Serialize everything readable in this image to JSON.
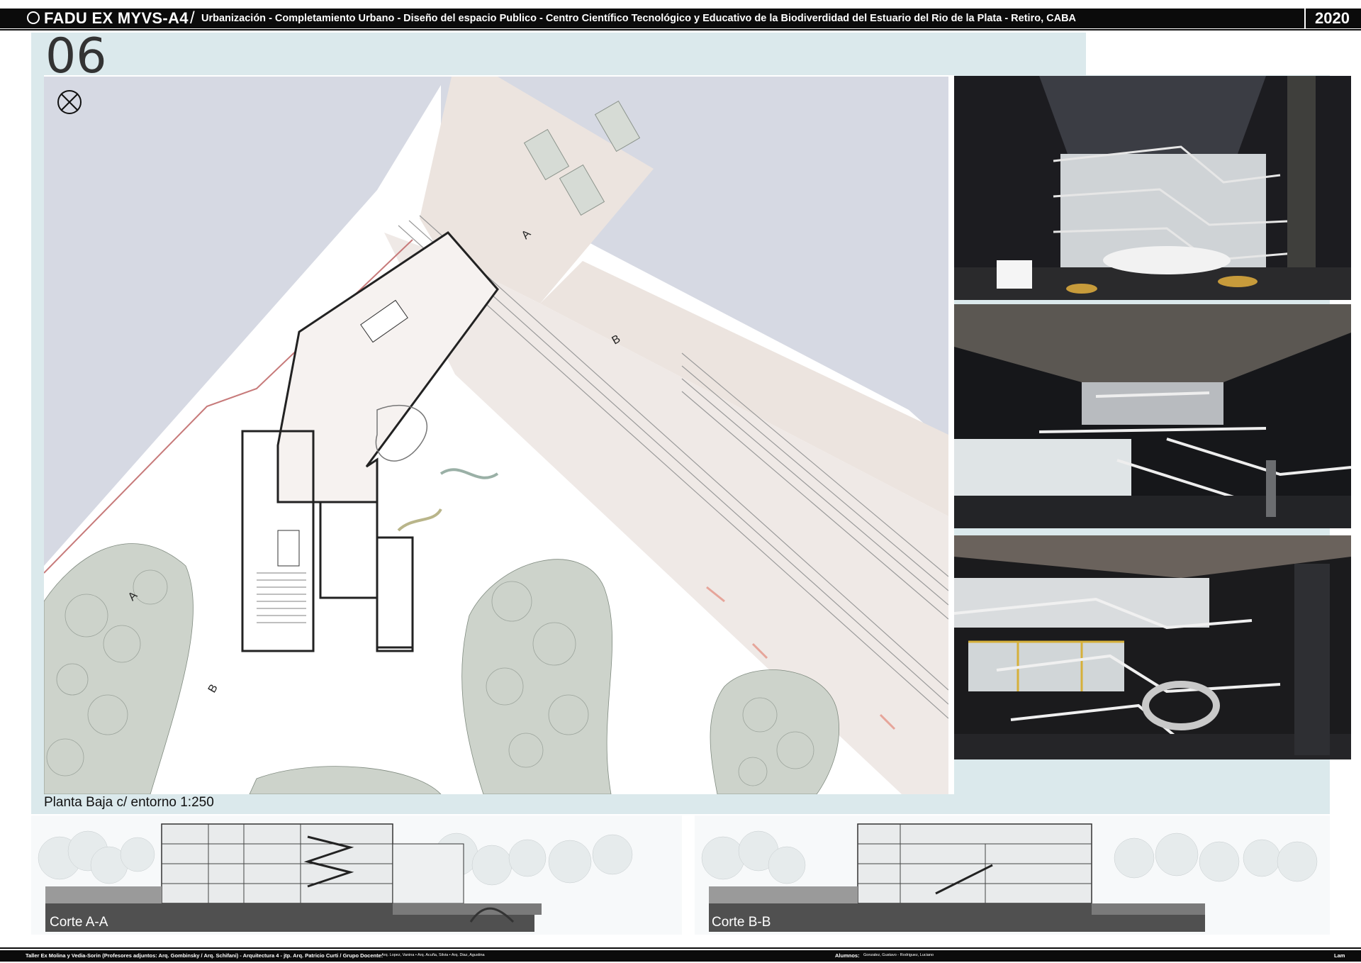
{
  "header": {
    "course": "FADU EX MYVS-A4",
    "project": "Urbanización - Completamiento Urbano - Diseño del espacio Publico - Centro Científico Tecnológico y Educativo de la Biodiverdidad del Estuario del Rio de la Plata   - Retiro, CABA",
    "year": "2020"
  },
  "page_number": "06",
  "plan": {
    "label": "Planta Baja c/ entorno 1:250",
    "cut_markers": [
      "A",
      "B",
      "A",
      "B"
    ]
  },
  "sections": [
    {
      "label": "Corte A-A"
    },
    {
      "label": "Corte B-B"
    }
  ],
  "footer": {
    "credits": "Taller Ex Molina y Vedia-Sorin (Profesores adjuntos:  Arq. Gombinsky / Arq. Schifani) - Arquitectura 4 - jtp. Arq. Patricio Curti / Grupo Docente:",
    "team": "Arq. Lopez, Vanina • Arq. Acuña, Silvia • Arq. Diaz, Agustina",
    "students_label": "Alumnos:",
    "students": "Gonzalez, Gustavo - Rodriguez, Luciano",
    "sheet": "Lam"
  },
  "colors": {
    "water": "#d6d9e3",
    "pier": "#ece4df",
    "band": "#dbe9ec",
    "header_bg": "#0b0b0b"
  }
}
